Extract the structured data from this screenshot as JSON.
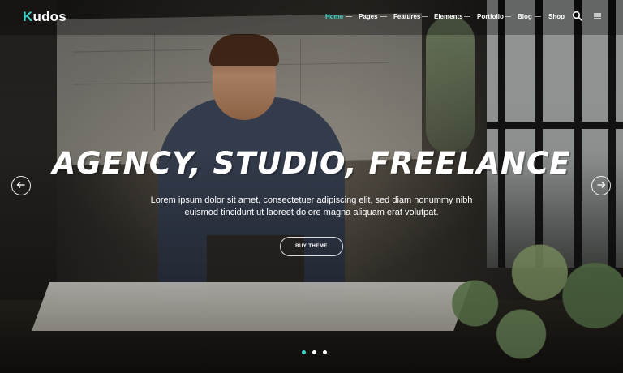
{
  "brand": {
    "logo_initial": "K",
    "logo_rest": "udos"
  },
  "nav": {
    "items": [
      {
        "label": "Home",
        "active": true
      },
      {
        "label": "Pages"
      },
      {
        "label": "Features"
      },
      {
        "label": "Elements"
      },
      {
        "label": "Portfolio"
      },
      {
        "label": "Blog"
      },
      {
        "label": "Shop"
      }
    ],
    "icons": [
      "search-icon",
      "menu-icon"
    ]
  },
  "hero": {
    "title": "AGENCY, STUDIO, FREELANCE",
    "line1": "Lorem ipsum dolor sit amet, consectetuer adipiscing elit, sed diam nonummy nibh",
    "line2": "euismod tincidunt ut laoreet dolore magna aliquam erat volutpat.",
    "button_label": "BUY THEME"
  },
  "slider": {
    "slide_count": 3,
    "active_slide": 1
  },
  "colors": {
    "accent": "#3fd2c6",
    "text": "#ffffff"
  }
}
